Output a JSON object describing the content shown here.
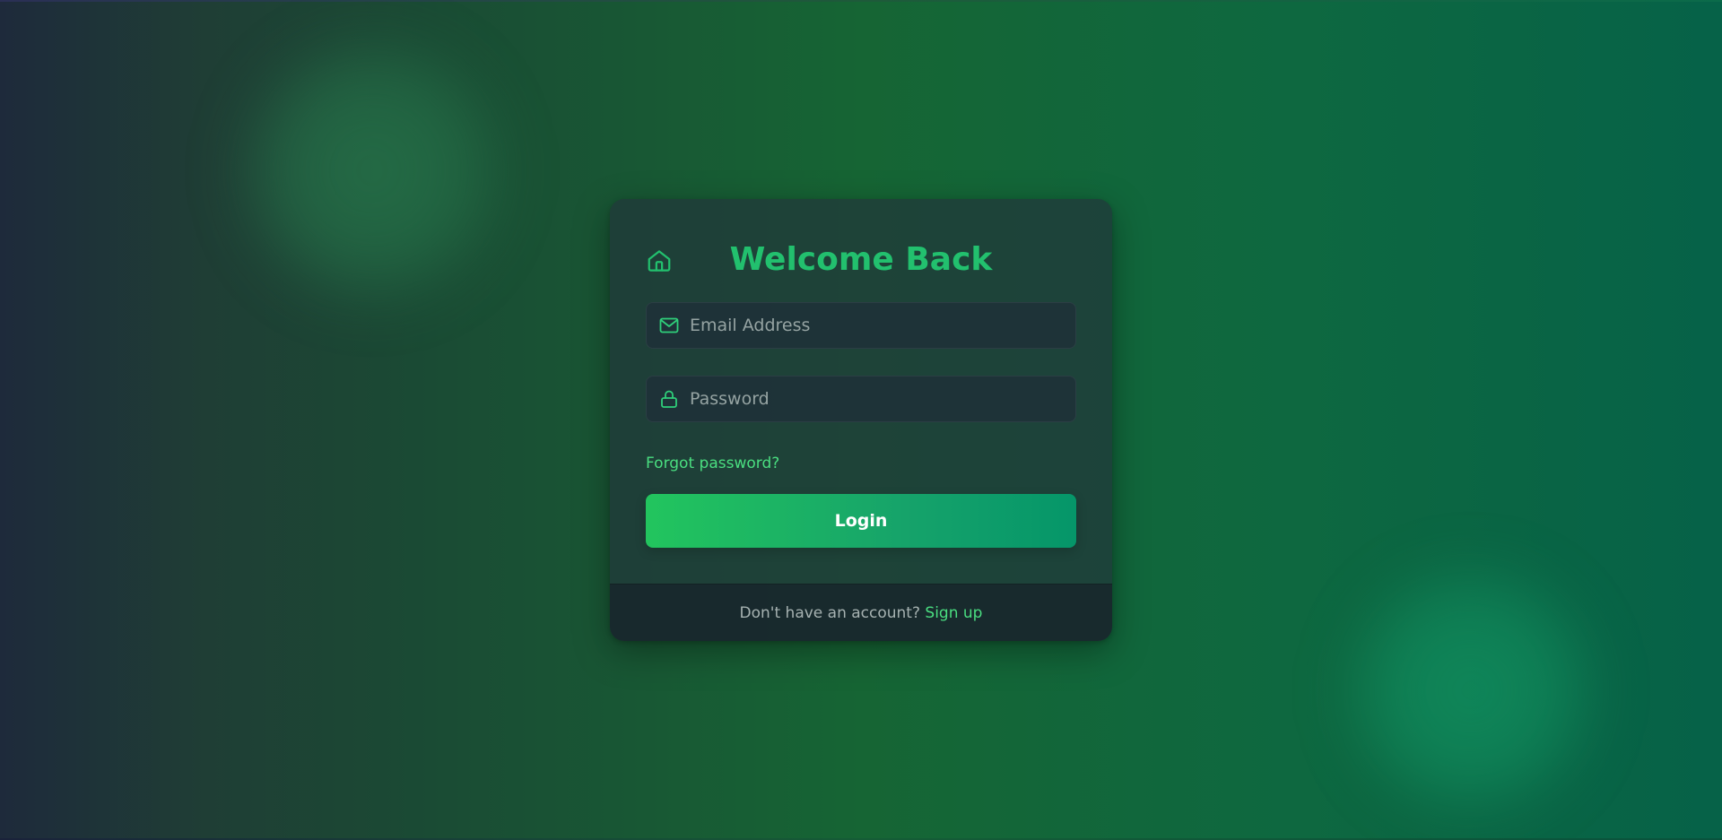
{
  "colors": {
    "accent": "#22c06e",
    "link": "#4ade80",
    "button_start": "#22c55e",
    "button_end": "#059669",
    "card": "#21363a"
  },
  "header": {
    "home_icon": "home-icon",
    "title": "Welcome Back"
  },
  "form": {
    "email": {
      "icon": "mail-icon",
      "placeholder": "Email Address",
      "value": ""
    },
    "password": {
      "icon": "lock-icon",
      "placeholder": "Password",
      "value": ""
    },
    "forgot_label": "Forgot password?",
    "login_label": "Login"
  },
  "footer": {
    "prompt": "Don't have an account?",
    "signup_label": "Sign up"
  }
}
